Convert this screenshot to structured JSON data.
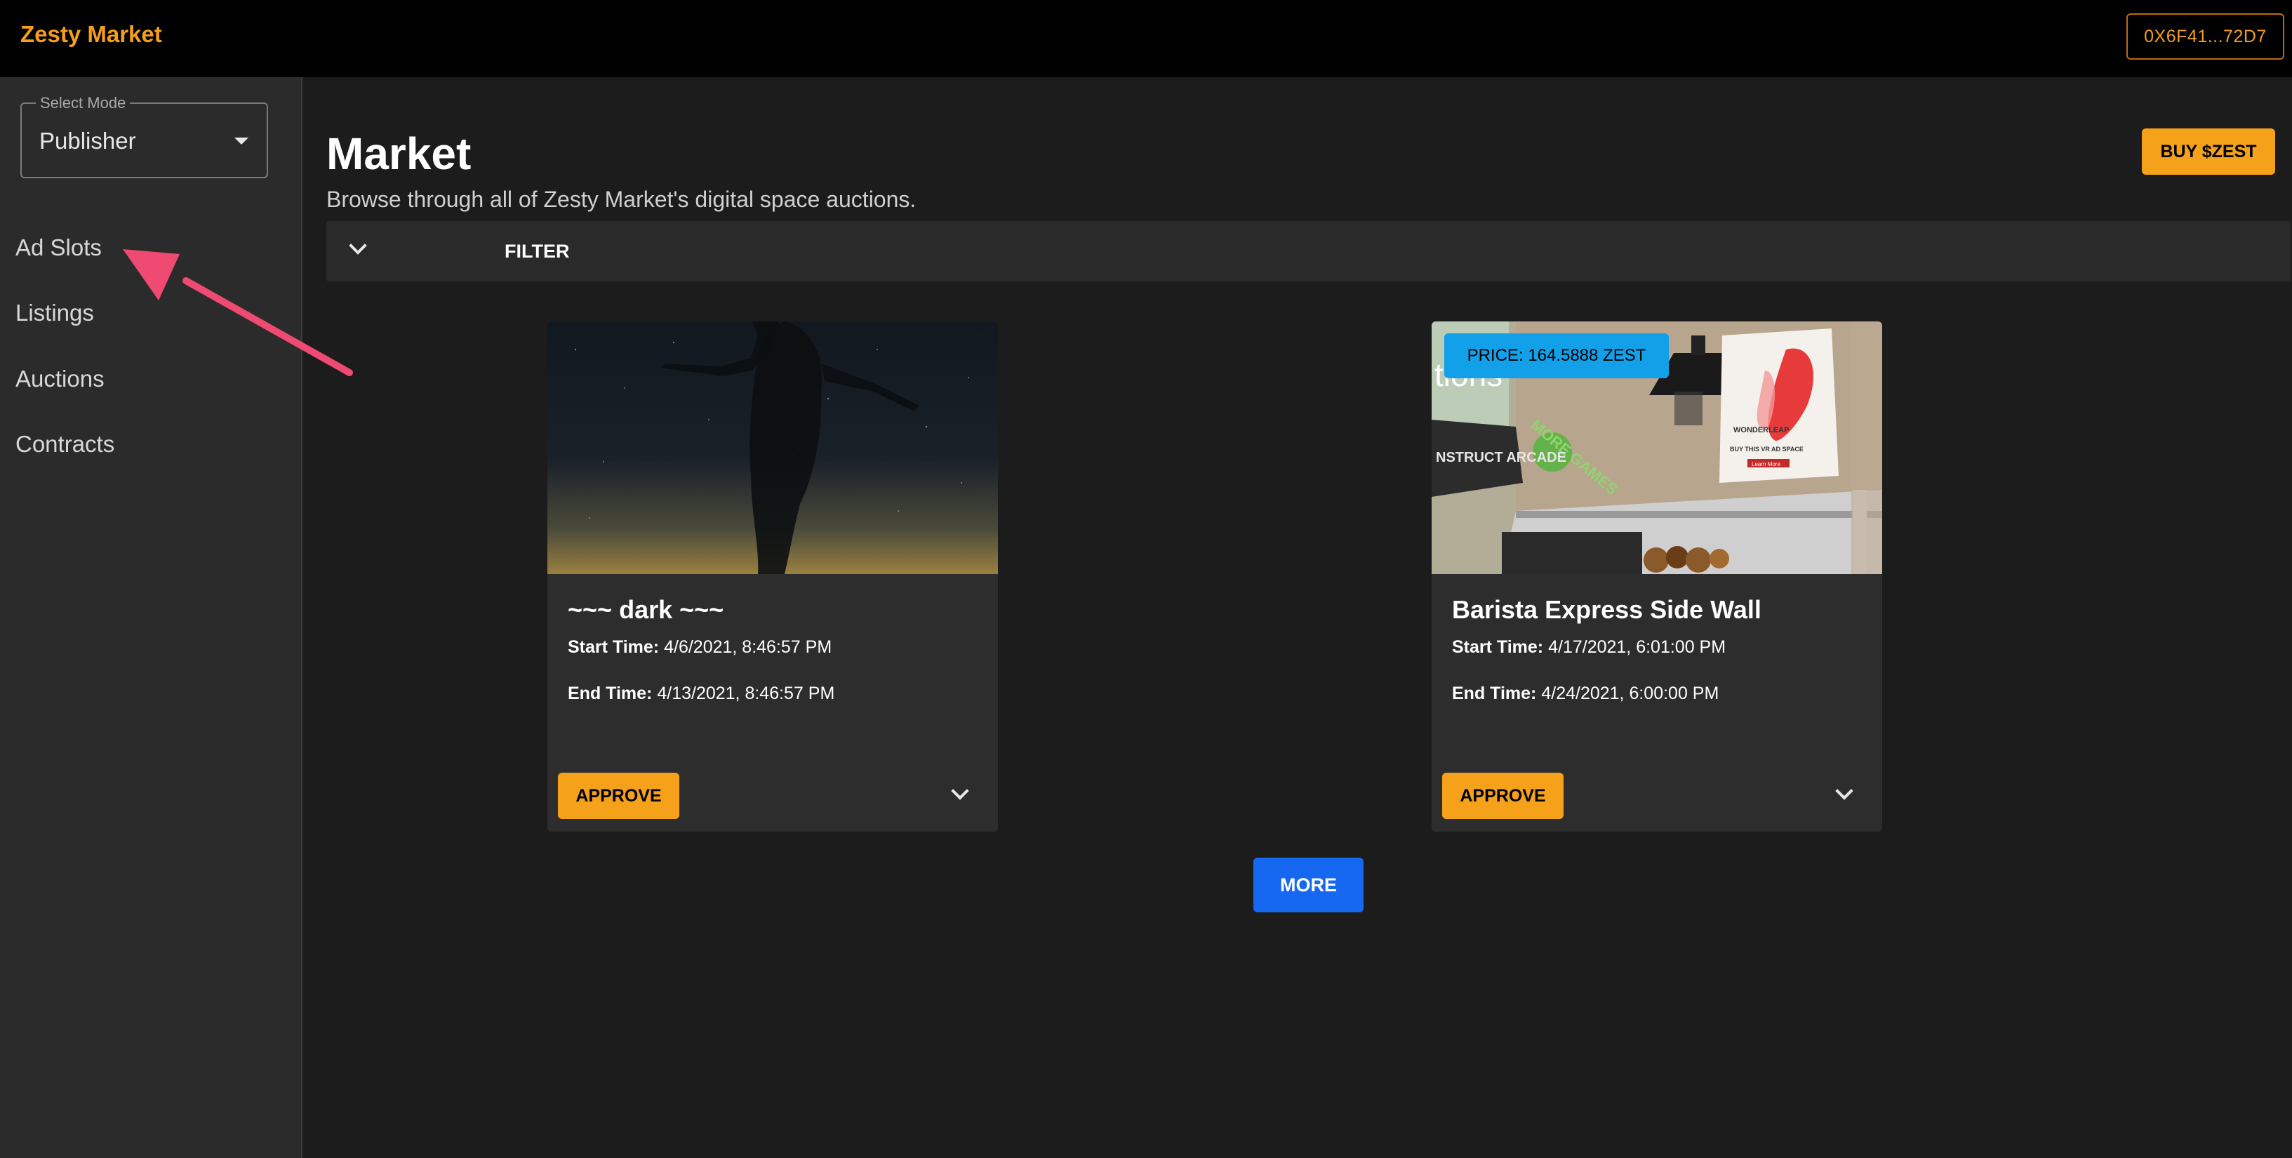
{
  "app": {
    "brand": "Zesty Market",
    "wallet": "0X6F41...72D7"
  },
  "sidebar": {
    "mode_label": "Select Mode",
    "mode_value": "Publisher",
    "items": [
      {
        "label": "Ad Slots"
      },
      {
        "label": "Listings"
      },
      {
        "label": "Auctions"
      },
      {
        "label": "Contracts"
      }
    ]
  },
  "main": {
    "title": "Market",
    "subtitle": "Browse through all of Zesty Market's digital space auctions.",
    "buy_button": "BUY $ZEST",
    "filter_label": "FILTER",
    "more_button": "MORE"
  },
  "cards": [
    {
      "title": "~~~ dark ~~~",
      "start_label": "Start Time:",
      "start_value": "4/6/2021, 8:46:57 PM",
      "end_label": "End Time:",
      "end_value": "4/13/2021, 8:46:57 PM",
      "approve": "APPROVE"
    },
    {
      "title": "Barista Express Side Wall",
      "price": "PRICE: 164.5888 ZEST",
      "start_label": "Start Time:",
      "start_value": "4/17/2021, 6:01:00 PM",
      "end_label": "End Time:",
      "end_value": "4/24/2021, 6:00:00 PM",
      "approve": "APPROVE",
      "image_text": {
        "tag": "tions",
        "sign": "NSTRUCT ARCADE",
        "poster_brand": "WONDERLEAP",
        "poster_text": "BUY THIS VR AD SPACE",
        "poster_button": "Learn More",
        "wall_text": "MORE GAMES"
      }
    }
  ],
  "colors": {
    "accent_orange": "#f5a21a",
    "brand_orange": "#f59e1a",
    "more_blue": "#1668f0",
    "price_blue": "#12a0e8",
    "annotation_pink": "#ee4a72"
  }
}
